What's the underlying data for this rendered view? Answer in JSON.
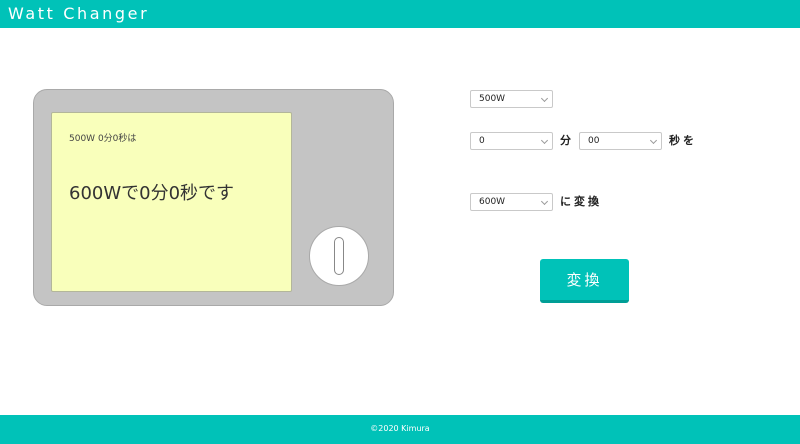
{
  "header": {
    "title": "Watt Changer"
  },
  "microwave": {
    "input_summary": "500W 0分0秒は",
    "result": "600Wで0分0秒です"
  },
  "form": {
    "source_wattage": "500W",
    "minutes": "0",
    "minutes_label": "分",
    "seconds": "00",
    "seconds_label": "秒を",
    "target_wattage": "600W",
    "target_label": "に変換",
    "convert_button": "変換"
  },
  "footer": {
    "copyright": "©2020 Kimura"
  },
  "colors": {
    "accent": "#00c2b8",
    "screen": "#f9ffbb",
    "microwave_body": "#c4c4c4"
  }
}
